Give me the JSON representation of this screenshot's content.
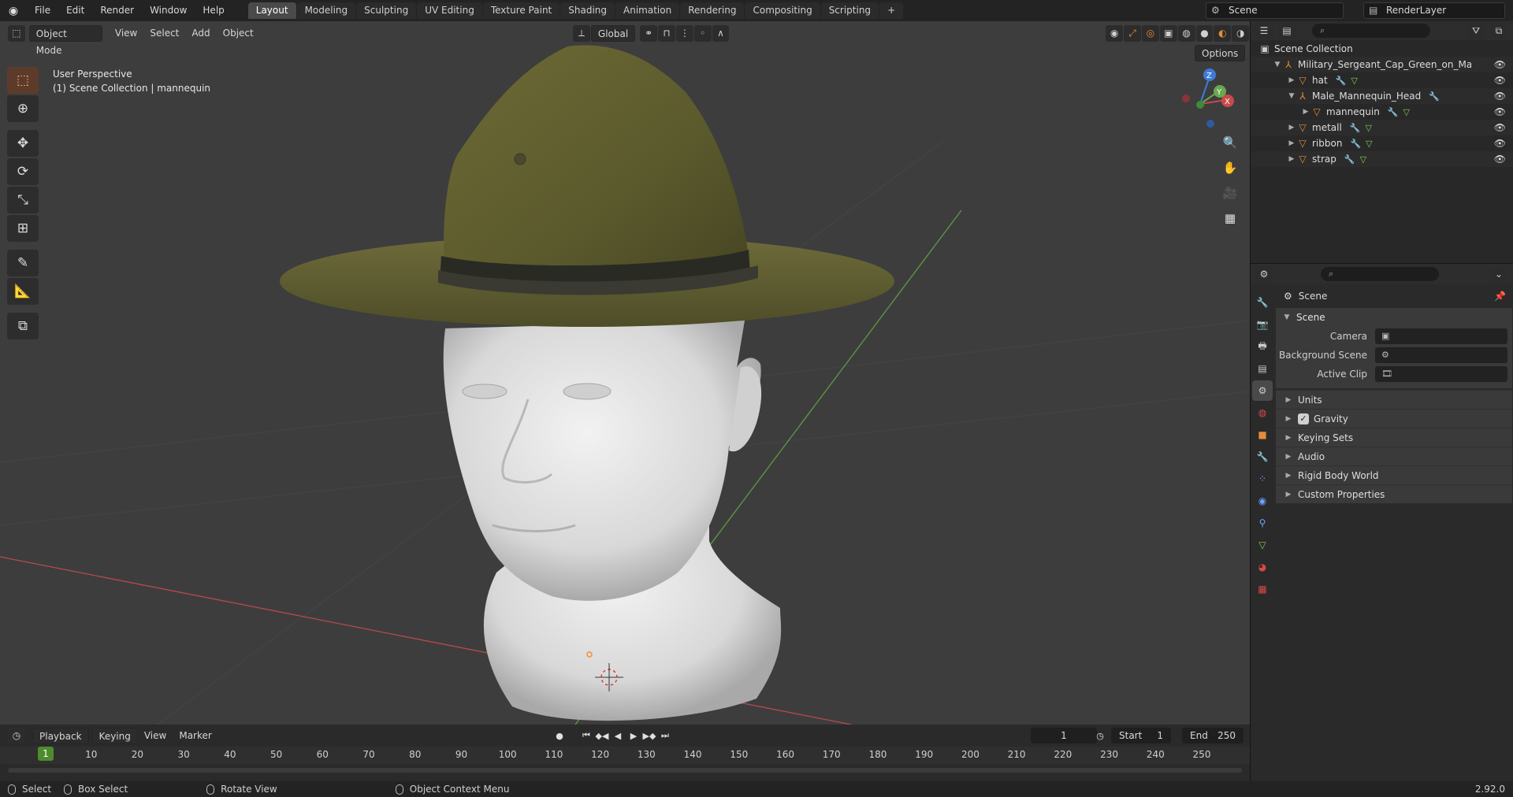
{
  "topbar": {
    "menus": [
      "File",
      "Edit",
      "Render",
      "Window",
      "Help"
    ],
    "workspaces": [
      "Layout",
      "Modeling",
      "Sculpting",
      "UV Editing",
      "Texture Paint",
      "Shading",
      "Animation",
      "Rendering",
      "Compositing",
      "Scripting"
    ],
    "active_workspace": "Layout",
    "add_tab": "+",
    "scene_name": "Scene",
    "view_layer": "RenderLayer"
  },
  "viewport": {
    "mode": "Object Mode",
    "menus": [
      "View",
      "Select",
      "Add",
      "Object"
    ],
    "transform_orientation": "Global",
    "options_label": "Options",
    "overlay_line1": "User Perspective",
    "overlay_line2": "(1) Scene Collection | mannequin",
    "gizmo": {
      "x": "X",
      "y": "Y",
      "z": "Z"
    }
  },
  "timeline": {
    "menus": [
      "Playback",
      "Keying",
      "View",
      "Marker"
    ],
    "current_frame": "1",
    "start_label": "Start",
    "start": "1",
    "end_label": "End",
    "end": "250",
    "ticks": [
      "10",
      "20",
      "30",
      "40",
      "50",
      "60",
      "70",
      "80",
      "90",
      "100",
      "110",
      "120",
      "130",
      "140",
      "150",
      "160",
      "170",
      "180",
      "190",
      "200",
      "210",
      "220",
      "230",
      "240",
      "250"
    ],
    "marker_frame": "1"
  },
  "statusbar": {
    "select": "Select",
    "box_select": "Box Select",
    "rotate_view": "Rotate View",
    "context_menu": "Object Context Menu",
    "version": "2.92.0"
  },
  "outliner": {
    "root": "Scene Collection",
    "items": [
      {
        "name": "Military_Sergeant_Cap_Green_on_Mannequin",
        "depth": 1,
        "expanded": true
      },
      {
        "name": "hat",
        "depth": 2,
        "expanded": false
      },
      {
        "name": "Male_Mannequin_Head",
        "depth": 2,
        "expanded": true
      },
      {
        "name": "mannequin",
        "depth": 3,
        "expanded": false
      },
      {
        "name": "metall",
        "depth": 2,
        "expanded": false
      },
      {
        "name": "ribbon",
        "depth": 2,
        "expanded": false
      },
      {
        "name": "strap",
        "depth": 2,
        "expanded": false
      }
    ]
  },
  "properties": {
    "context": "Scene",
    "panel_title": "Scene",
    "camera_label": "Camera",
    "background_scene_label": "Background Scene",
    "active_clip_label": "Active Clip",
    "subpanels": [
      "Units",
      "Gravity",
      "Keying Sets",
      "Audio",
      "Rigid Body World",
      "Custom Properties"
    ],
    "gravity_checked": true
  },
  "colors": {
    "accent_orange": "#e58d3c",
    "active_tool": "#5d3b2b",
    "frame_green": "#4e8b2d",
    "x_axis": "#c84a4a",
    "y_axis": "#6aa84f"
  }
}
